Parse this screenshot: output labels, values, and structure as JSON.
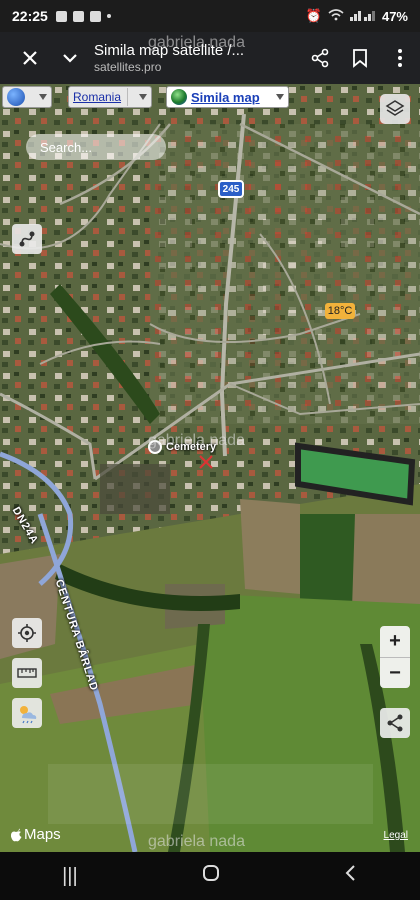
{
  "status": {
    "time": "22:25",
    "battery": "47%"
  },
  "browser": {
    "title": "Simila map satellite /...",
    "url": "satellites.pro"
  },
  "map_ui": {
    "country": "Romania",
    "map_type": "Simila map",
    "search_placeholder": "Search...",
    "road_shield": "245",
    "temperature": "18°C",
    "poi_label": "Cemetery",
    "road_dn24a": "DN24A",
    "road_centura": "CENTURA BÂRLAD",
    "zoom_in": "+",
    "zoom_out": "−",
    "attribution": "Maps",
    "legal": "Legal"
  },
  "watermark": "gabriela nada",
  "icons": [
    "globe-icon",
    "layers-icon",
    "route-icon",
    "locate-icon",
    "ruler-icon",
    "weather-icon",
    "share-icon",
    "close-icon",
    "chevron-down-icon",
    "bookmark-icon",
    "more-icon",
    "apple-icon"
  ],
  "nav": {
    "recents": "|||",
    "home": "○",
    "back": "<"
  }
}
